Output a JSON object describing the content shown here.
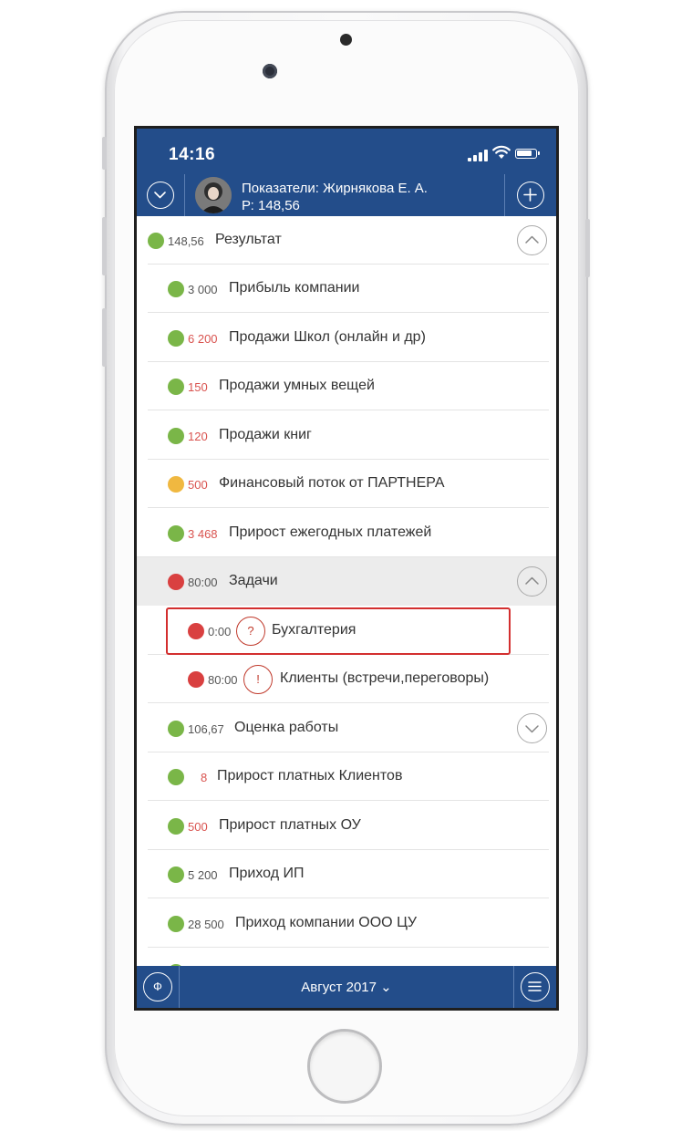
{
  "status": {
    "time": "14:16"
  },
  "header": {
    "title": "Показатели: Жирнякова Е. А.",
    "subtitle": "Р: 148,56"
  },
  "rows": [
    {
      "value": "148,56",
      "label": "Результат",
      "status": "green"
    },
    {
      "value": "3 000",
      "label": "Прибыль компании",
      "status": "green"
    },
    {
      "value": "6 200",
      "label": "Продажи Школ (онлайн и др)",
      "status": "green"
    },
    {
      "value": "150",
      "label": "Продажи умных вещей",
      "status": "green"
    },
    {
      "value": "120",
      "label": "Продажи книг",
      "status": "green"
    },
    {
      "value": "500",
      "label": "Финансовый поток от ПАРТНЕРА",
      "status": "yellow"
    },
    {
      "value": "3 468",
      "label": "Прирост ежегодных платежей",
      "status": "green"
    },
    {
      "value": "80:00",
      "label": "Задачи",
      "status": "red"
    },
    {
      "value": "0:00",
      "label": "Бухгалтерия",
      "status": "red",
      "badge": "?"
    },
    {
      "value": "80:00",
      "label": "Клиенты (встречи,переговоры)",
      "status": "red",
      "badge": "!"
    },
    {
      "value": "106,67",
      "label": "Оценка работы",
      "status": "green"
    },
    {
      "value": "8",
      "label": "Прирост платных Клиентов",
      "status": "green"
    },
    {
      "value": "500",
      "label": "Прирост платных ОУ",
      "status": "green"
    },
    {
      "value": "5 200",
      "label": "Приход ИП",
      "status": "green"
    },
    {
      "value": "28 500",
      "label": "Приход компании ООО ЦУ",
      "status": "green"
    }
  ],
  "footer": {
    "left_icon": "Ф",
    "month": "Август 2017 ⌄"
  },
  "colors": {
    "brand": "#234d8a",
    "green": "#7ab648",
    "red": "#d94040",
    "yellow": "#f0b840",
    "highlight": "#d32f2f"
  }
}
